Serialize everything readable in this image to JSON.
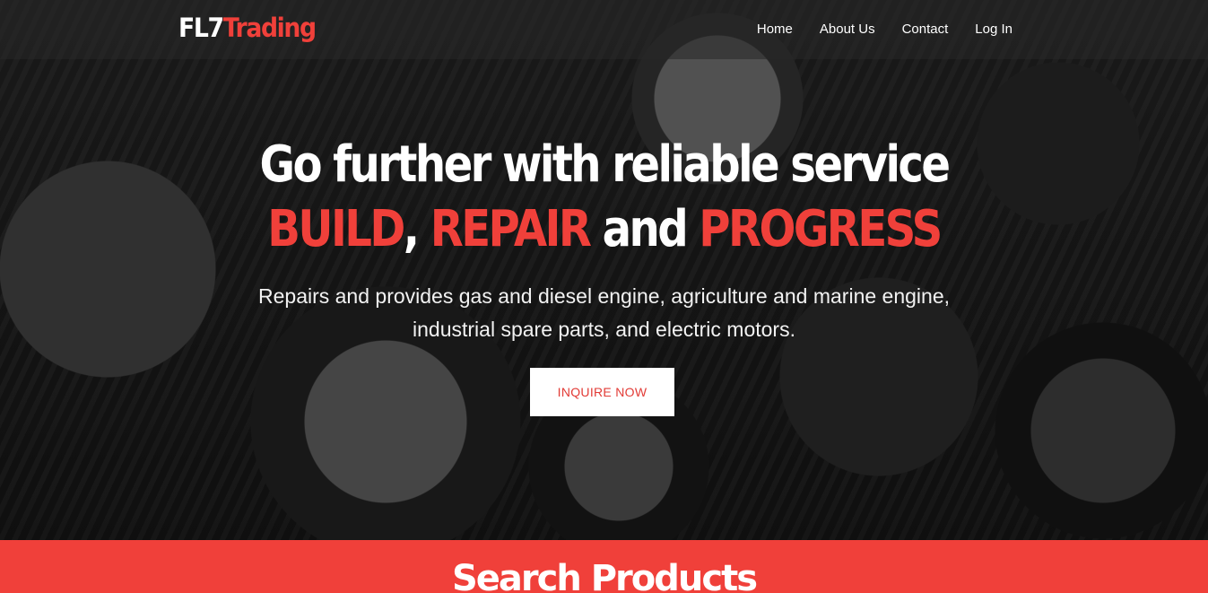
{
  "brand": {
    "part1": "FL7",
    "part2": "Trading"
  },
  "nav": {
    "items": [
      "Home",
      "About Us",
      "Contact",
      "Log In"
    ]
  },
  "hero": {
    "headline_line1": "Go further with reliable service",
    "headline_build": "BUILD",
    "headline_comma": ",",
    "headline_repair": "REPAIR",
    "headline_and": "and",
    "headline_progress": "PROGRESS",
    "subtext": "Repairs and provides gas and diesel engine, agriculture and marine engine, industrial spare parts, and electric motors.",
    "button_label": "INQUIRE NOW"
  },
  "search": {
    "title": "Search Products"
  },
  "colors": {
    "accent": "#f0403a",
    "text_light": "#ffffff",
    "button_text": "#e23b36"
  }
}
